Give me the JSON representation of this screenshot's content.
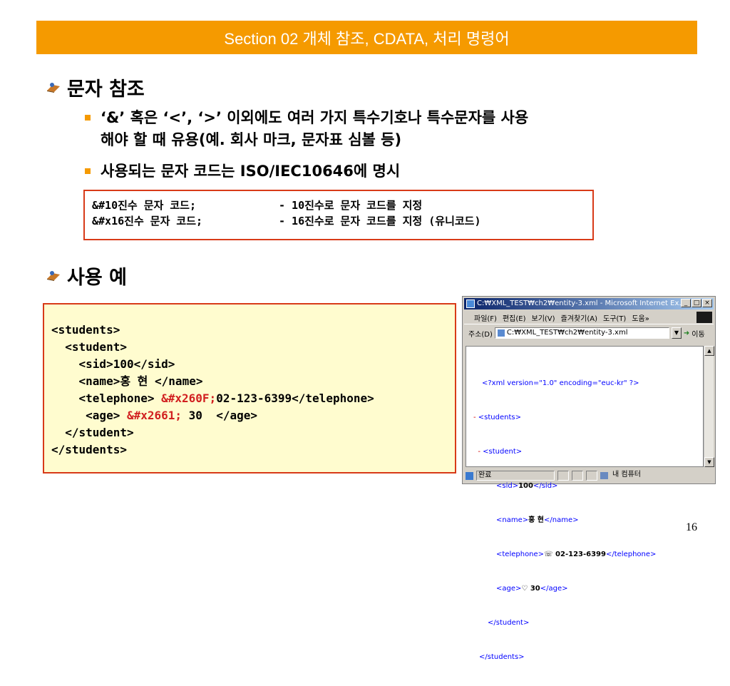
{
  "header": {
    "title": "Section 02 개체 참조, CDATA, 처리 명령어"
  },
  "section1": {
    "heading": "문자 참조",
    "bullets": [
      {
        "line1": "‘&’ 혹은 ‘<’, ‘>’ 이외에도 여러 가지 특수기호나 특수문자를 사용",
        "line2": "해야 할 때 유용(예. 회사 마크, 문자표 심볼 등)"
      },
      {
        "line1": "사용되는 문자 코드는 ISO/IEC10646에 명시"
      }
    ],
    "code_box": [
      {
        "syntax": "&#10진수 문자 코드;",
        "desc": "- 10진수로 문자 코드를 지정"
      },
      {
        "syntax": "&#x16진수 문자 코드;",
        "desc": "- 16진수로 문자 코드를 지정 (유니코드)"
      }
    ]
  },
  "section2": {
    "heading": "사용 예",
    "code_lines": [
      {
        "pre": "<students>"
      },
      {
        "pre": "  <student>"
      },
      {
        "pre": "    <sid>100</sid>"
      },
      {
        "pre": "    <name>홍 현 </name>"
      },
      {
        "pre": "    <telephone> ",
        "red": "&#x260F;",
        "post": "02-123-6399</telephone>"
      },
      {
        "pre": "     <age> ",
        "red": "&#x2661;",
        "post": " 30  </age>"
      },
      {
        "pre": "  </student>"
      },
      {
        "pre": "</students>"
      }
    ]
  },
  "browser": {
    "title": "C:₩XML_TEST₩ch2₩entity-3.xml - Microsoft Internet Ex...",
    "menu": [
      "파일(F)",
      "편집(E)",
      "보기(V)",
      "즐겨찾기(A)",
      "도구(T)",
      "도움»"
    ],
    "address_label": "주소(D)",
    "address_value": "C:₩XML_TEST₩ch2₩entity-3.xml",
    "go_label": "이동",
    "xml_decl": "<?xml version=\"1.0\" encoding=\"euc-kr\" ?>",
    "xml_lines": [
      {
        "prefix": "- ",
        "tag": "<students>"
      },
      {
        "prefix": "  - ",
        "tag": "<student>"
      },
      {
        "open": "<sid>",
        "text": "100",
        "close": "</sid>"
      },
      {
        "open": "<name>",
        "text": "홍 현",
        "close": "</name>"
      },
      {
        "open": "<telephone>",
        "text": "☏ 02-123-6399",
        "close": "</telephone>"
      },
      {
        "open": "<age>",
        "text": "♡ 30",
        "close": "</age>"
      },
      {
        "tag": "</student>"
      },
      {
        "tag": "</students>"
      }
    ],
    "status_left": "완료",
    "status_right": "내 컴퓨터"
  },
  "page_number": "16"
}
